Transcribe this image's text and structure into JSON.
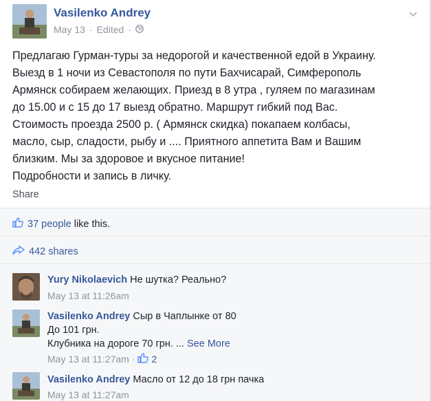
{
  "post": {
    "author": "Vasilenko Andrey",
    "date": "May 13",
    "edited": "Edited",
    "separator": "·",
    "lines": [
      "Предлагаю Гурман-туры за недорогой и качественной едой в Украину.",
      "Выезд в 1 ночи из Севастополя по пути Бахчисарай, Симферополь",
      "Армянск собираем желающих. Приезд в 8 утра , гуляем по магазинам",
      "до 15.00 и с 15 до 17 выезд обратно. Маршрут гибкий под Вас.",
      "Стоимость проезда 2500 р. ( Армянск скидка) покапаем колбасы,",
      "масло, сыр, сладости, рыбу и .... Приятного аппетита Вам и Вашим",
      "близким. Мы за здоровое и вкусное питание!",
      "Подробности и запись в личку."
    ],
    "share_label": "Share"
  },
  "likes": {
    "count_text": "37 people",
    "suffix": " like this."
  },
  "shares": {
    "text": "442 shares"
  },
  "comments": [
    {
      "name": "Yury Nikolaevich",
      "lines": [
        "Не шутка? Реально?"
      ],
      "time": "May 13 at 11:26am"
    },
    {
      "name": "Vasilenko Andrey",
      "lines": [
        "Сыр в Чаплынке от 80",
        "До 101 грн.",
        "Клубника на дороге 70 грн. ..."
      ],
      "see_more": "See More",
      "time": "May 13 at 11:27am",
      "like_sep": "·",
      "like_count": "2"
    },
    {
      "name": "Vasilenko Andrey",
      "lines": [
        "Масло от 12 до 18 грн пачка"
      ],
      "time": "May 13 at 11:27am"
    }
  ],
  "colors": {
    "link": "#365899",
    "meta": "#90949c",
    "panel": "#f6f7f9"
  }
}
